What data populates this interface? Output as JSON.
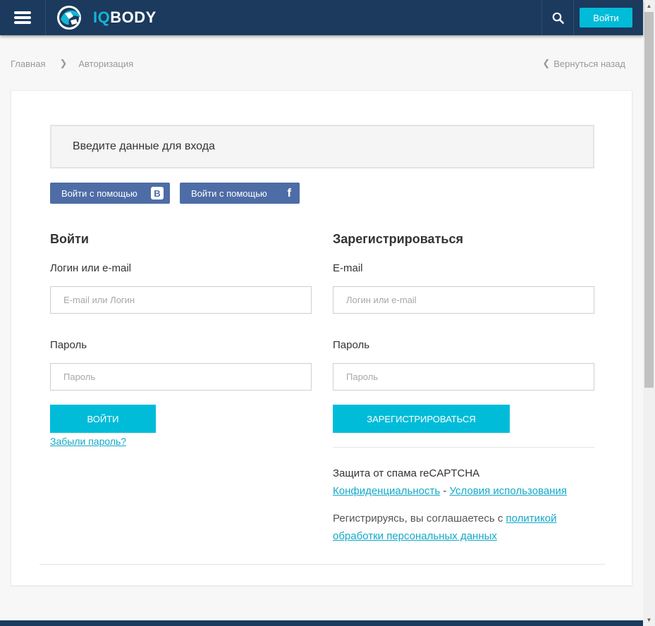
{
  "header": {
    "logo_iq": "IQ",
    "logo_body": "BODY",
    "login_button": "Войти",
    "menu_icon": "hamburger-menu-icon",
    "search_icon": "search-icon",
    "colors": {
      "bar": "#1b3a5e",
      "accent": "#00bcd9"
    }
  },
  "breadcrumb": {
    "items": [
      "Главная",
      "Авторизация"
    ],
    "back_label": "Вернуться назад"
  },
  "notice": {
    "text": "Введите данные для входа"
  },
  "social": {
    "vk_label": "Войти с помощью",
    "vk_badge": "В",
    "fb_label": "Войти с помощью",
    "fb_badge": "f"
  },
  "login": {
    "title": "Войти",
    "field1_label": "Логин или e-mail",
    "field1_placeholder": "E-mail или Логин",
    "field2_label": "Пароль",
    "field2_placeholder": "Пароль",
    "submit": "ВОЙТИ",
    "forgot": "Забыли пароль?"
  },
  "register": {
    "title": "Зарегистрироваться",
    "field1_label": "E-mail",
    "field1_placeholder": "Логин или e-mail",
    "field2_label": "Пароль",
    "field2_placeholder": "Пароль",
    "submit": "ЗАРЕГИСТРИРОВАТЬСЯ",
    "recaptcha_text": "Защита от спама reCAPTCHA",
    "privacy_link": "Конфиденциальность",
    "dash": "-",
    "terms_link": "Условия использования",
    "consent_text": "Регистрируясь, вы соглашаетесь с",
    "consent_link": "политикой обработки персональных данных"
  }
}
